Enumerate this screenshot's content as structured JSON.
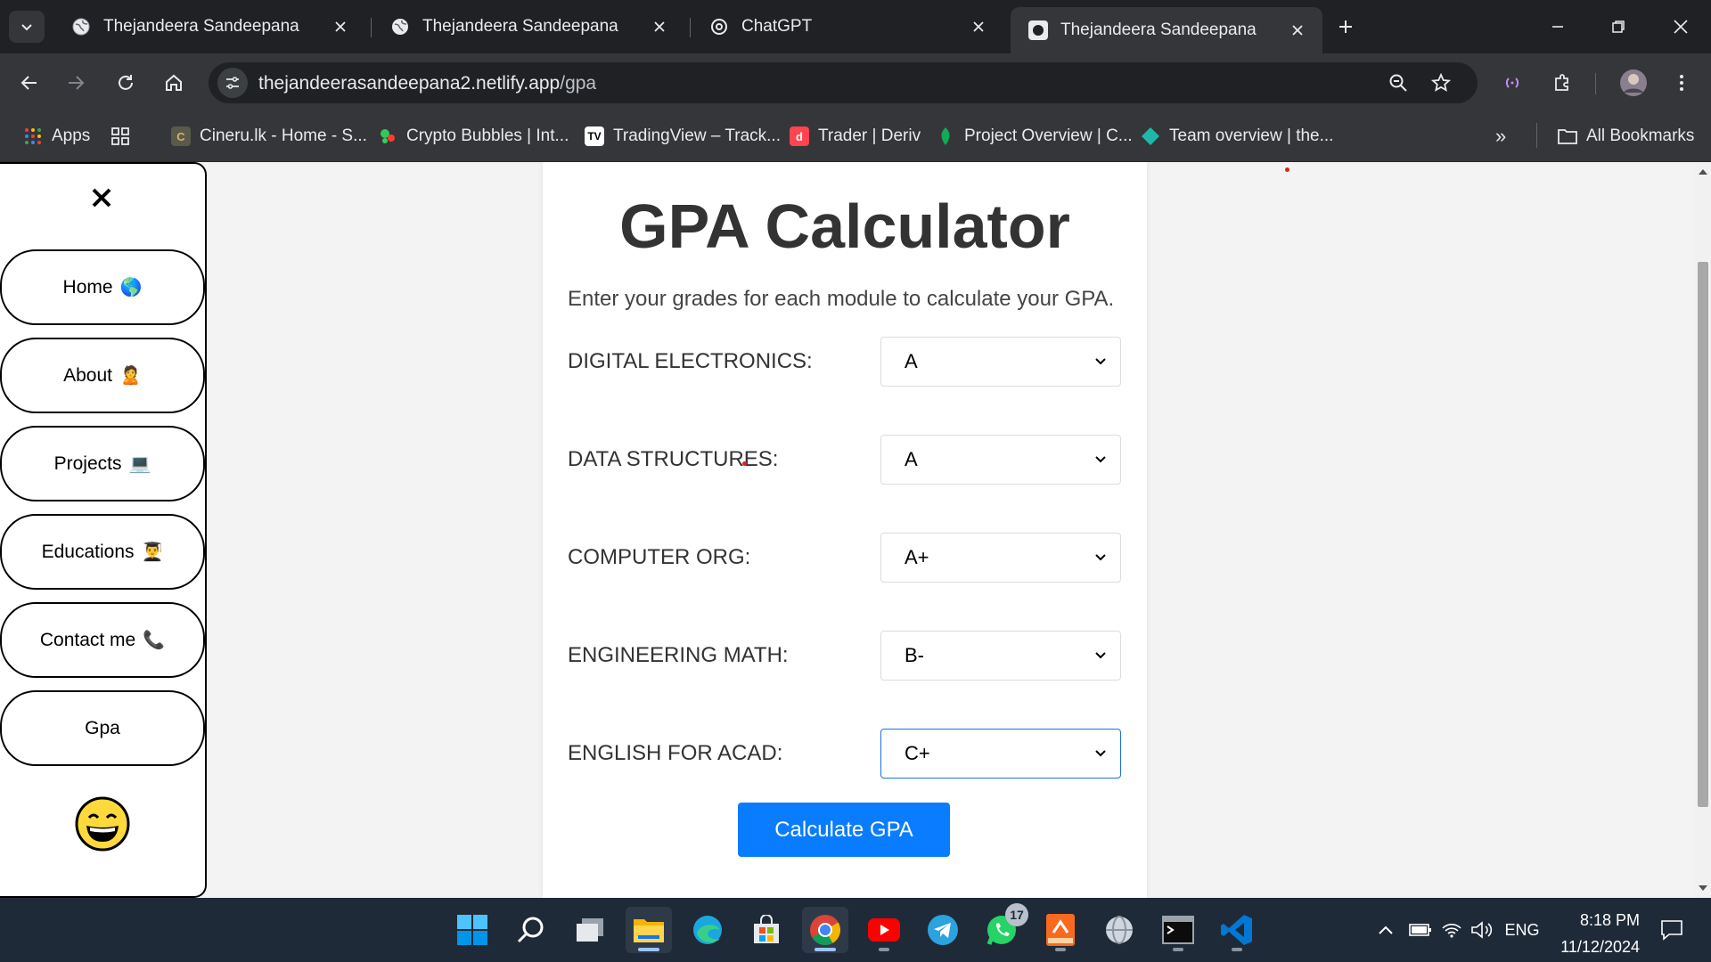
{
  "browser": {
    "tabs": [
      {
        "title": "Thejandeera Sandeepana",
        "active": false
      },
      {
        "title": "Thejandeera Sandeepana",
        "active": false
      },
      {
        "title": "ChatGPT",
        "active": false
      },
      {
        "title": "Thejandeera Sandeepana",
        "active": true
      }
    ],
    "url_host": "thejandeerasandeepana2.netlify.app",
    "url_path": "/gpa",
    "bookmarks": [
      {
        "label": "Apps",
        "icon": "apps-grid-icon"
      },
      {
        "label": "Cineru.lk - Home - S...",
        "icon": "cineru-icon"
      },
      {
        "label": "Crypto Bubbles | Int...",
        "icon": "crypto-bubbles-icon"
      },
      {
        "label": "TradingView – Track...",
        "icon": "tradingview-icon"
      },
      {
        "label": "Trader | Deriv",
        "icon": "deriv-icon"
      },
      {
        "label": "Project Overview | C...",
        "icon": "project-leaf-icon"
      },
      {
        "label": "Team overview | the...",
        "icon": "diamond-icon"
      }
    ],
    "all_bookmarks_label": "All Bookmarks",
    "overflow_label": "»"
  },
  "sidebar": {
    "nav": [
      {
        "label": "Home",
        "emoji": "🌎"
      },
      {
        "label": "About",
        "emoji": "🙎"
      },
      {
        "label": "Projects",
        "emoji": "💻"
      },
      {
        "label": "Educations",
        "emoji": "👨‍🎓"
      },
      {
        "label": "Contact me",
        "emoji": "📞"
      },
      {
        "label": "Gpa",
        "emoji": ""
      }
    ]
  },
  "calculator": {
    "title": "GPA Calculator",
    "description": "Enter your grades for each module to calculate your GPA.",
    "modules": [
      {
        "label": "DIGITAL ELECTRONICS:",
        "grade": "A"
      },
      {
        "label": "DATA STRUCTURES:",
        "grade": "A"
      },
      {
        "label": "COMPUTER ORG:",
        "grade": "A+"
      },
      {
        "label": "ENGINEERING MATH:",
        "grade": "B-"
      },
      {
        "label": "ENGLISH FOR ACAD:",
        "grade": "C+"
      }
    ],
    "button_label": "Calculate GPA"
  },
  "taskbar": {
    "apps": [
      "windows-start-icon",
      "search-icon",
      "task-view-icon",
      "file-explorer-icon",
      "edge-icon",
      "microsoft-store-icon",
      "chrome-icon",
      "youtube-icon",
      "telegram-icon",
      "whatsapp-icon",
      "reader-icon",
      "terminal-like-icon",
      "cmd-icon",
      "vscode-icon"
    ],
    "whatsapp_badge": "17",
    "language": "ENG",
    "time": "8:18 PM",
    "date": "11/12/2024"
  },
  "colors": {
    "primary_button": "#0a7cff",
    "focus_border": "#1a73e8",
    "title_text": "#333333"
  }
}
